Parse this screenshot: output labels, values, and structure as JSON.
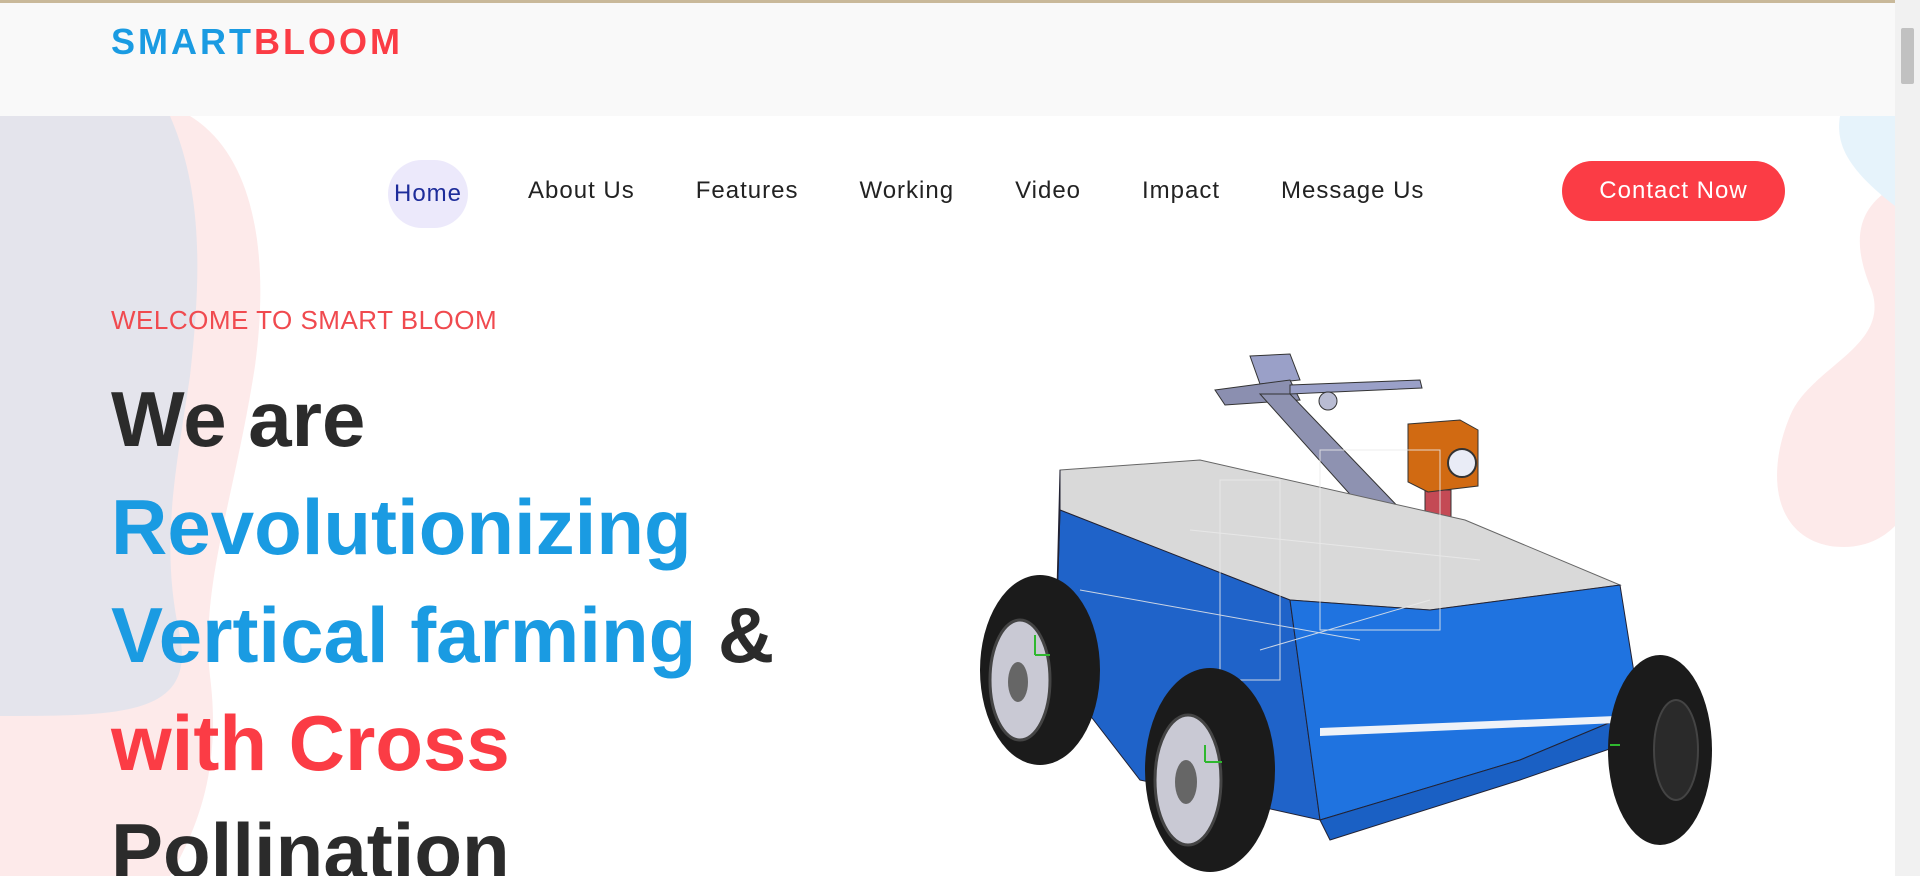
{
  "brand": {
    "part1": "SMART",
    "part2": "BLOOM"
  },
  "nav": {
    "items": [
      {
        "label": "Home",
        "active": true
      },
      {
        "label": "About Us"
      },
      {
        "label": "Features"
      },
      {
        "label": "Working"
      },
      {
        "label": "Video"
      },
      {
        "label": "Impact"
      },
      {
        "label": "Message Us"
      }
    ],
    "cta_label": "Contact Now"
  },
  "hero": {
    "eyebrow": "WELCOME TO SMART BLOOM",
    "line1": "We are",
    "line2": "Revolutionizing",
    "line3a": "Vertical farming",
    "line3b": "&",
    "line4a": "with",
    "line4b": "Cross",
    "line5": "Pollination"
  },
  "colors": {
    "blue": "#1a9be2",
    "red": "#fb3c45",
    "nav_active_bg": "#ece9fb",
    "dark": "#2b2b2b"
  },
  "icons": {
    "hero_image": "robot-vehicle-illustration"
  }
}
